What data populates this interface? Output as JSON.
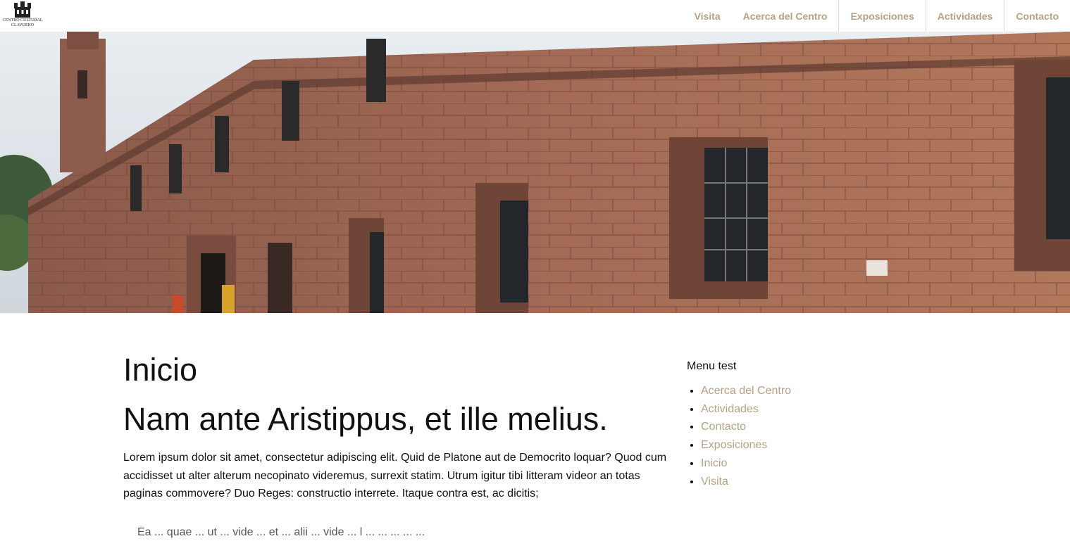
{
  "header": {
    "logo_line1": "CENTRO CULTURAL",
    "logo_line2": "CLAVIJERO",
    "nav": [
      {
        "label": "Visita"
      },
      {
        "label": "Acerca del Centro"
      },
      {
        "label": "Exposiciones"
      },
      {
        "label": "Actividades"
      },
      {
        "label": "Contacto"
      }
    ]
  },
  "main": {
    "title": "Inicio",
    "subtitle": "Nam ante Aristippus, et ille melius.",
    "paragraph": "Lorem ipsum dolor sit amet, consectetur adipiscing elit. Quid de Platone aut de Democrito loquar? Quod cum accidisset ut alter alterum necopinato videremus, surrexit statim. Utrum igitur tibi litteram videor an totas paginas commovere? Duo Reges: constructio interrete. Itaque contra est, ac dicitis;",
    "next_item": "Ea ... quae ... ut ... vide ... et ... alii ... vide ... l ... ... ... ... ..."
  },
  "sidebar": {
    "title": "Menu test",
    "items": [
      {
        "label": "Acerca del Centro"
      },
      {
        "label": "Actividades"
      },
      {
        "label": "Contacto"
      },
      {
        "label": "Exposiciones"
      },
      {
        "label": "Inicio"
      },
      {
        "label": "Visita"
      }
    ]
  },
  "colors": {
    "nav_link": "#b6a284",
    "stone": "#9c6a58"
  }
}
